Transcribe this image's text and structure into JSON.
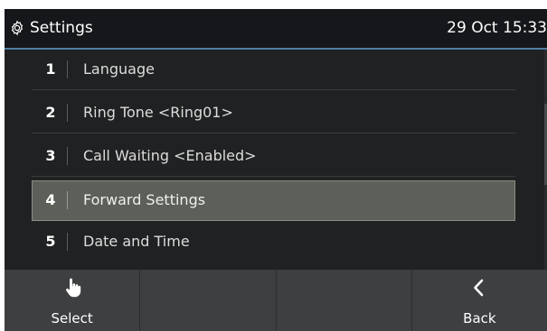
{
  "header": {
    "title": "Settings",
    "title_icon": "gear-icon",
    "datetime": "29 Oct 15:33"
  },
  "menu": {
    "items": [
      {
        "number": "1",
        "label": "Language"
      },
      {
        "number": "2",
        "label": "Ring Tone <Ring01>"
      },
      {
        "number": "3",
        "label": "Call Waiting <Enabled>"
      },
      {
        "number": "4",
        "label": "Forward Settings"
      },
      {
        "number": "5",
        "label": "Date and Time"
      }
    ],
    "selected_index": 3
  },
  "softkeys": {
    "select": {
      "label": "Select",
      "icon": "hand-pointer-icon"
    },
    "empty1": {
      "label": ""
    },
    "empty2": {
      "label": ""
    },
    "back": {
      "label": "Back",
      "icon": "chevron-left-icon"
    }
  },
  "colors": {
    "background": "#202122",
    "title_bar": "#16171a",
    "title_underline": "#4f7fa5",
    "selected_row": "#5c6058",
    "softkey_bar": "#3d3f41"
  }
}
